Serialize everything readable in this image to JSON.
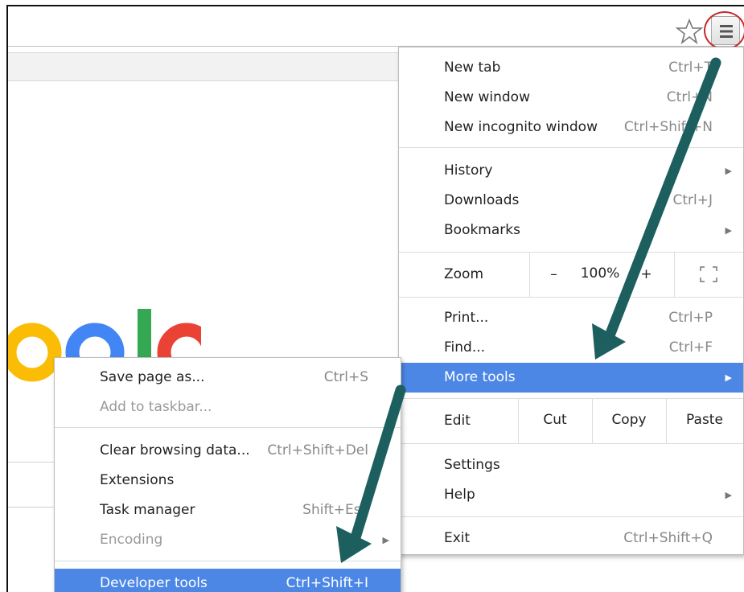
{
  "browser": {
    "star_icon": "star-outline-icon",
    "menu_icon": "hamburger-menu-icon",
    "highlight_color": "#c62828"
  },
  "main_menu": {
    "group1": [
      {
        "label": "New tab",
        "shortcut": "Ctrl+T"
      },
      {
        "label": "New window",
        "shortcut": "Ctrl+N"
      },
      {
        "label": "New incognito window",
        "shortcut": "Ctrl+Shift+N"
      }
    ],
    "group2": [
      {
        "label": "History",
        "shortcut": ""
      },
      {
        "label": "Downloads",
        "shortcut": "Ctrl+J"
      },
      {
        "label": "Bookmarks",
        "shortcut": ""
      }
    ],
    "zoom": {
      "label": "Zoom",
      "minus": "–",
      "value": "100%",
      "plus": "+"
    },
    "group3": [
      {
        "label": "Print...",
        "shortcut": "Ctrl+P"
      },
      {
        "label": "Find...",
        "shortcut": "Ctrl+F"
      },
      {
        "label": "More tools",
        "shortcut": ""
      }
    ],
    "edit": {
      "label": "Edit",
      "cut": "Cut",
      "copy": "Copy",
      "paste": "Paste"
    },
    "group4": [
      {
        "label": "Settings",
        "shortcut": ""
      },
      {
        "label": "Help",
        "shortcut": ""
      }
    ],
    "exit": {
      "label": "Exit",
      "shortcut": "Ctrl+Shift+Q"
    }
  },
  "sub_menu": {
    "group1": [
      {
        "label": "Save page as...",
        "shortcut": "Ctrl+S"
      },
      {
        "label": "Add to taskbar...",
        "shortcut": ""
      }
    ],
    "group2": [
      {
        "label": "Clear browsing data...",
        "shortcut": "Ctrl+Shift+Del"
      },
      {
        "label": "Extensions",
        "shortcut": ""
      },
      {
        "label": "Task manager",
        "shortcut": "Shift+Esc"
      },
      {
        "label": "Encoding",
        "shortcut": ""
      }
    ],
    "developer": {
      "label": "Developer tools",
      "shortcut": "Ctrl+Shift+I"
    }
  },
  "colors": {
    "menu_highlight": "#4c87e6",
    "arrow": "#1d5f5f",
    "google_blue": "#4285f4",
    "google_red": "#ea4335",
    "google_yellow": "#fbbc05",
    "google_green": "#34a853"
  }
}
